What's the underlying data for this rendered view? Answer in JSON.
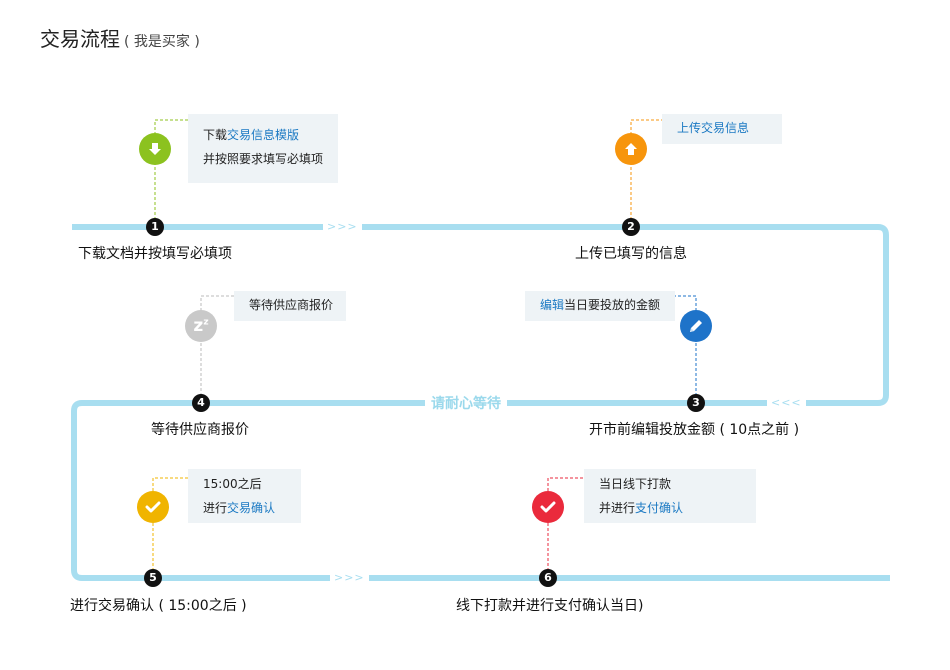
{
  "title": "交易流程",
  "subtitle": "( 我是买家 )",
  "colors": {
    "track": "#a8def0",
    "green": "#8cc21f",
    "orange": "#f7950c",
    "gray": "#c9c9c9",
    "blue": "#1e73c9",
    "yellow": "#f0b400",
    "red": "#ea2a3c"
  },
  "arrows": {
    "forward": ">>>",
    "backward": "<<<"
  },
  "wait_text": "请耐心等待",
  "steps": [
    {
      "num": "1",
      "label": "下载文档并按填写必填项",
      "icon": "download-icon",
      "box": {
        "line1_prefix": "下载",
        "line1_link": "交易信息模版",
        "line2": "并按照要求填写必填项"
      }
    },
    {
      "num": "2",
      "label": "上传已填写的信息",
      "icon": "upload-icon",
      "box": {
        "line1_link": "上传交易信息"
      }
    },
    {
      "num": "3",
      "label": "开市前编辑投放金额 ( 10点之前 )",
      "icon": "pencil-icon",
      "box": {
        "line1_link": "编辑",
        "line1_suffix": "当日要投放的金额"
      }
    },
    {
      "num": "4",
      "label": "等待供应商报价",
      "icon": "sleep-icon",
      "box": {
        "line1": "等待供应商报价"
      }
    },
    {
      "num": "5",
      "label": "进行交易确认 ( 15:00之后 )",
      "icon": "check-icon",
      "box": {
        "line1": "15:00之后",
        "line2_prefix": "进行",
        "line2_link": "交易确认"
      }
    },
    {
      "num": "6",
      "label": "线下打款并进行支付确认当日)",
      "icon": "check-icon",
      "box": {
        "line1": "当日线下打款",
        "line2_prefix": "并进行",
        "line2_link": "支付确认"
      }
    }
  ]
}
